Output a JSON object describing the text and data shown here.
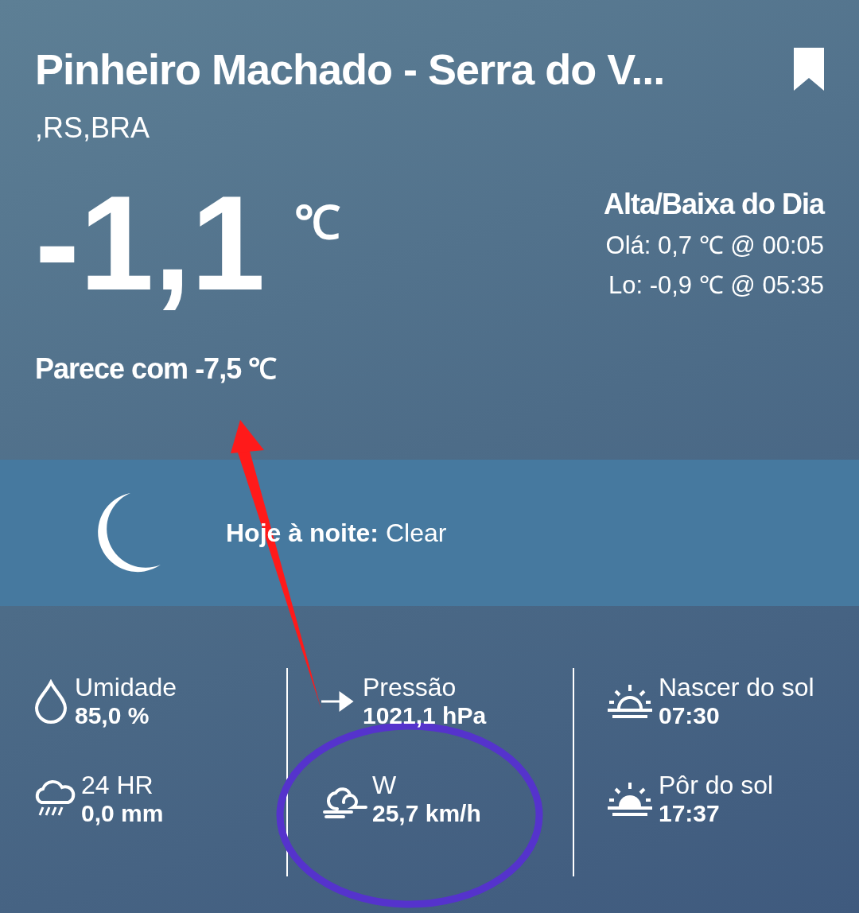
{
  "location": {
    "title": "Pinheiro Machado - Serra do V...",
    "subtitle": ",RS,BRA"
  },
  "current": {
    "temperature": "-1,1",
    "unit": "℃",
    "feels_like": "Parece com -7,5 ℃"
  },
  "high_low": {
    "title": "Alta/Baixa do Dia",
    "high": "Olá: 0,7 ℃ @ 00:05",
    "low": "Lo: -0,9 ℃ @ 05:35"
  },
  "forecast": {
    "text": "**Hoje à noite:** Clear"
  },
  "details": [
    {
      "kind": "humidity",
      "label": "Umidade",
      "value": "85,0 %"
    },
    {
      "kind": "pressure",
      "label": "Pressão",
      "value": "1021,1 hPa"
    },
    {
      "kind": "sunrise",
      "label": "Nascer do sol",
      "value": "07:30"
    },
    {
      "kind": "rain",
      "label": "24 HR",
      "value": "0,0 mm"
    },
    {
      "kind": "wind",
      "label": "W",
      "value": "25,7 km/h"
    },
    {
      "kind": "sunset",
      "label": "Pôr do sol",
      "value": "17:37"
    }
  ]
}
